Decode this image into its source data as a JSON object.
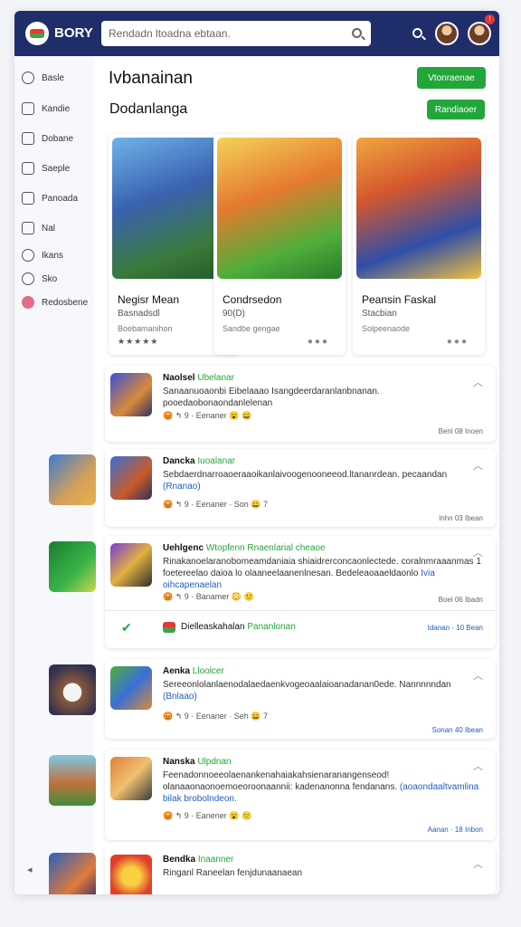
{
  "header": {
    "app_name": "BORY",
    "search_placeholder": "Rendadn ltoadna ebtaan."
  },
  "sidebar": {
    "items": [
      {
        "label": "Basle",
        "icon": "search-icon"
      },
      {
        "label": "Kandie",
        "icon": "edit-icon"
      },
      {
        "label": "Dobane",
        "icon": "document-icon"
      },
      {
        "label": "Saeple",
        "icon": "pencil-icon"
      },
      {
        "label": "Panoada",
        "icon": "calendar-icon"
      },
      {
        "label": "Nal",
        "icon": "grid-icon"
      },
      {
        "label": "Ikans",
        "icon": "clock-icon"
      },
      {
        "label": "Sko",
        "icon": "search-icon"
      },
      {
        "label": "Redosbene",
        "icon": "profile-icon"
      }
    ]
  },
  "main": {
    "title": "Ivbanainan",
    "top_button": "Vtonraenae",
    "section_title": "Dodanlanga",
    "section_button": "Randiaoer",
    "cards": [
      {
        "title": "Negisr Mean",
        "sub": "Basnadsdl",
        "meta": "Boebamanihon",
        "stars": "★★★★★"
      },
      {
        "title": "Condrsedon",
        "sub": "90(D)",
        "meta": "Sandbe gengae",
        "stars": ""
      },
      {
        "title": "Peansin Faskal",
        "sub": "Stacbian",
        "meta": "Solpeenaode",
        "stars": ""
      }
    ],
    "posts": [
      {
        "name": "Naolsel",
        "tag": "Ubelanar",
        "text": "Sanaanuoaonbi Eibelaaao Isangdeerdaranlanbnanan. pooedaobonaondanlelenan",
        "link": "",
        "reactions": "😡 ↰ 9 · Eenaner 😮 😀",
        "time": "Benl 08 Inoen",
        "time_blue": false
      },
      {
        "name": "Dancka",
        "tag": "Iuoalanar",
        "text": "Sebdaerdnarroaoeraaoikanlaivoogenooneeod.ltananrdean. pecaandan",
        "link": "(Rnanao)",
        "reactions": "😡 ↰ 9 · Eenaner · Son 😀 7",
        "time": "Inhn 03 Ibean",
        "time_blue": false
      },
      {
        "name": "Uehlgenc",
        "tag": "Wtopfenn Rnaenlarial cheaoe",
        "text": "Rinakanoelaranobomeamdaniaia shiaidrerconcaonlectede. coralnmraaanmas 1 foetereelao daioa lo olaaneelaanenlnesan. Bedeleaoaaeldaonlo",
        "link": "Ivia oihcapenaelan",
        "reactions": "😡 ↰ 9 · Banamer 😳 🙂",
        "time": "Boel 06 Ibadn",
        "time_blue": false,
        "reply": {
          "text": "Dielleaskahalan",
          "tag": "Pananlonan",
          "time": "Idanan · 10 Bean"
        }
      },
      {
        "name": "Aenka",
        "tag": "Lloolcer",
        "text": "Sereeonlolanlaenodalaedaenkvogeoaalaioanadanan0ede. Nannnnndan",
        "link": "(Bnlaao)",
        "reactions": "😡 ↰ 9 · Eenaner · Seh 😀 7",
        "time": "Sonan 40 Ibean",
        "time_blue": true
      },
      {
        "name": "Nanska",
        "tag": "Ulpdnan",
        "text": "Feenadonnoeeolaenankenahaiakahsienaranangenseod! olanaaonaonoemoeoroonaannii: kadenanonna fendanans.",
        "link": "(aoaondaaltvamlina bilak brobolndeon.",
        "reactions": "😡 ↰ 9 · Eanener 😮 🙁",
        "time": "Aanan · 18 Inbon",
        "time_blue": true
      },
      {
        "name": "Bendka",
        "tag": "Inaanner",
        "text": "Ringanl Raneelan fenjdunaanaean",
        "link": "",
        "reactions": "",
        "time": "",
        "time_blue": false
      }
    ]
  },
  "colors": {
    "header_bg": "#1f2d6b",
    "accent_green": "#22a63a",
    "link_blue": "#1e5fbf",
    "notification_red": "#e53935"
  }
}
